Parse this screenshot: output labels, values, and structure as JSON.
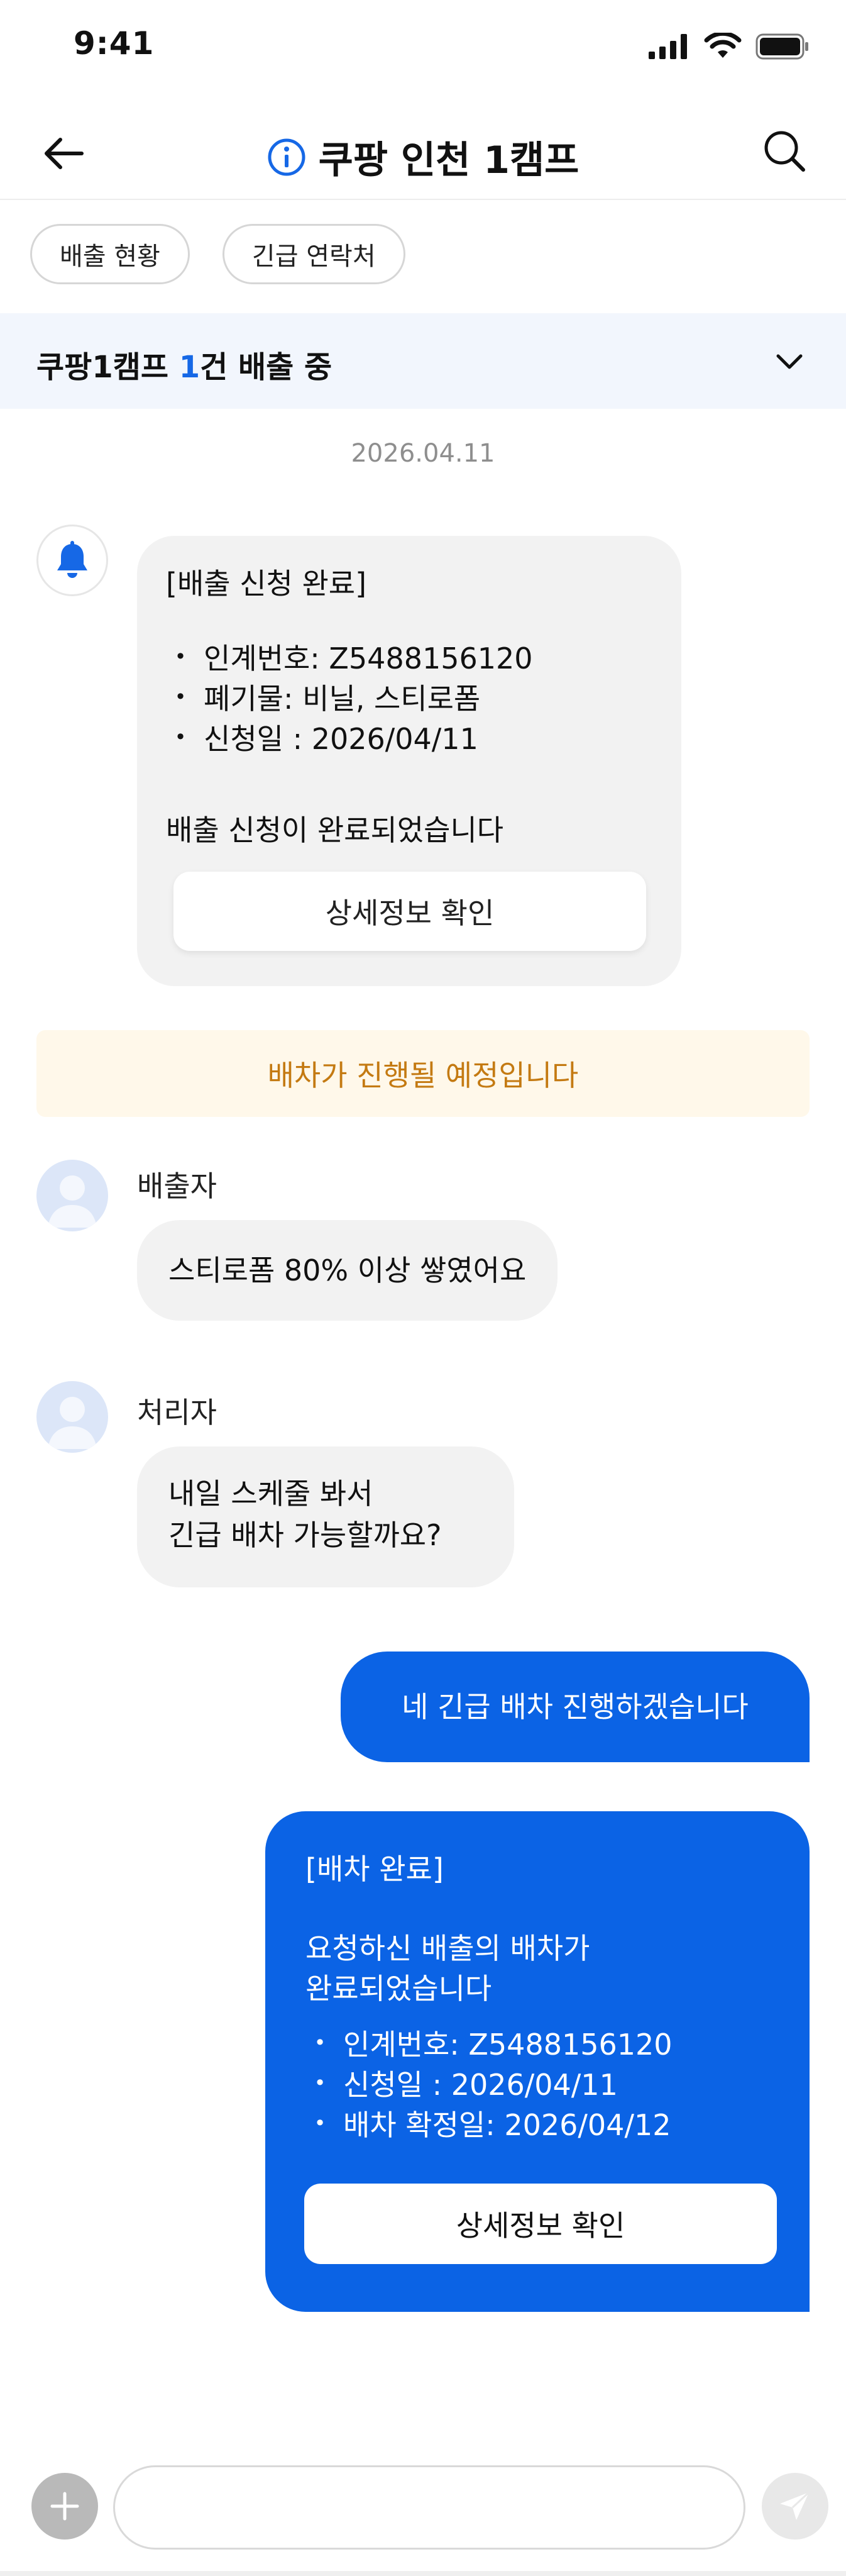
{
  "status_bar": {
    "time": "9:41"
  },
  "header": {
    "title": "쿠팡 인천 1캠프"
  },
  "chips": [
    {
      "label": "배출 현황"
    },
    {
      "label": "긴급 연락처"
    }
  ],
  "banner": {
    "prefix": "쿠팡1캠프 ",
    "count": "1",
    "suffix": "건 배출 중"
  },
  "date_separator": "2026.04.11",
  "notice": {
    "title": "[배출 신청 완료]",
    "items": [
      "인계번호: Z5488156120",
      "폐기물: 비닐, 스티로폼",
      "신청일 : 2026/04/11"
    ],
    "footer": "배출 신청이 완료되었습니다",
    "button": "상세정보 확인"
  },
  "dispatch_note": "배차가 진행될 예정입니다",
  "messages": [
    {
      "sender": "배출자",
      "text": "스티로폼 80% 이상 쌓였어요"
    },
    {
      "sender": "처리자",
      "lines": [
        "내일 스케줄 봐서",
        "긴급 배차 가능할까요?"
      ]
    },
    {
      "text": "네 긴급 배차 진행하겠습니다"
    }
  ],
  "dispatch_complete": {
    "title": "[배차 완료]",
    "lines": [
      "요청하신 배출의 배차가",
      "완료되었습니다"
    ],
    "items": [
      "인계번호: Z5488156120",
      "신청일 : 2026/04/11",
      "배차 확정일: 2026/04/12"
    ],
    "button": "상세정보 확인"
  },
  "composer": {
    "placeholder": ""
  },
  "colors": {
    "accent": "#0b63e5",
    "banner_bg": "#f2f6fd",
    "note_bg": "#fff8ea",
    "note_text": "#c47a12",
    "bubble_in": "#f2f2f2"
  },
  "icons": {
    "back": "arrow-left-icon",
    "info": "info-icon",
    "search": "search-icon",
    "chevron": "chevron-down-icon",
    "bell": "bell-icon",
    "avatar": "person-icon",
    "plus": "plus-icon",
    "send": "send-icon"
  }
}
